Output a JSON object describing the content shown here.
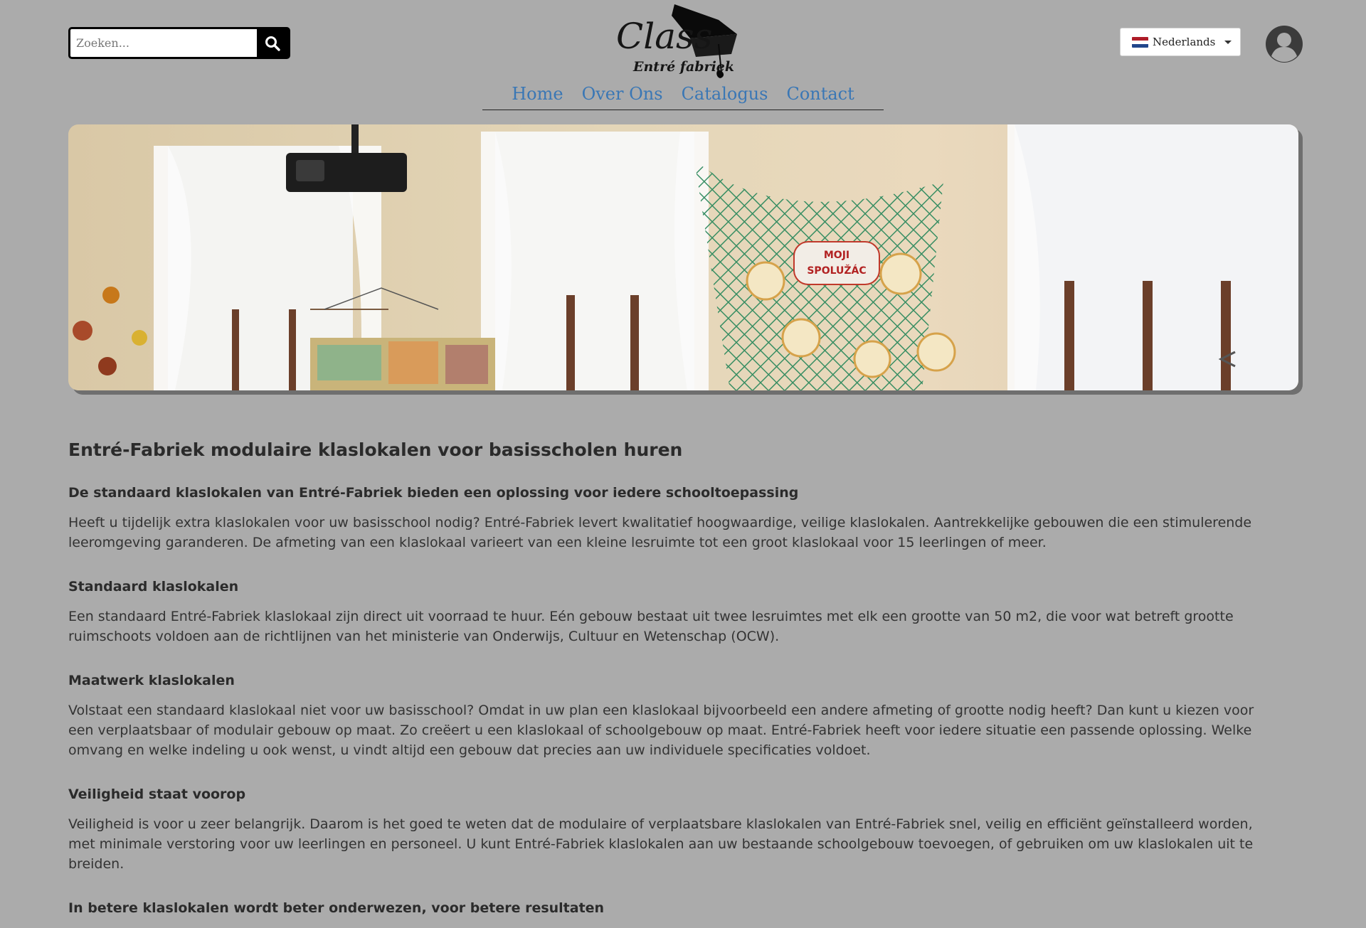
{
  "header": {
    "search": {
      "placeholder": "Zoeken..."
    },
    "logo": {
      "title": "Class",
      "subtitle": "Entré fabriek"
    },
    "language": {
      "selected": "Nederlands",
      "flag_colors": [
        "#ae1c28",
        "#ffffff",
        "#21468b"
      ]
    },
    "nav": [
      {
        "label": "Home"
      },
      {
        "label": "Over Ons"
      },
      {
        "label": "Catalogus"
      },
      {
        "label": "Contact"
      }
    ]
  },
  "banner": {
    "sign_text_1": "MOJI",
    "sign_text_2": "SPOLUŽÁC"
  },
  "content": {
    "title": "Entré-Fabriek modulaire klaslokalen voor basisscholen huren",
    "sections": [
      {
        "heading": "De standaard klaslokalen van Entré-Fabriek bieden een oplossing voor iedere schooltoepassing",
        "text": "Heeft u tijdelijk extra klaslokalen voor uw basisschool nodig? Entré-Fabriek levert kwalitatief hoogwaardige, veilige klaslokalen. Aantrekkelijke gebouwen die een stimulerende leeromgeving garanderen. De afmeting van een klaslokaal varieert van een kleine lesruimte tot een groot klaslokaal voor 15 leerlingen of meer."
      },
      {
        "heading": "Standaard klaslokalen",
        "text": "Een standaard Entré-Fabriek klaslokaal zijn direct uit voorraad te huur. Eén gebouw bestaat uit twee lesruimtes met elk een grootte van 50 m2, die voor wat betreft grootte ruimschoots voldoen aan de richtlijnen van het ministerie van Onderwijs, Cultuur en Wetenschap (OCW)."
      },
      {
        "heading": "Maatwerk klaslokalen",
        "text": "Volstaat een standaard klaslokaal niet voor uw basisschool? Omdat in uw plan een klaslokaal bijvoorbeeld een andere afmeting of grootte nodig heeft? Dan kunt u kiezen voor een verplaatsbaar of modulair gebouw op maat. Zo creëert u een klaslokaal of schoolgebouw op maat. Entré-Fabriek heeft voor iedere situatie een passende oplossing. Welke omvang en welke indeling u ook wenst, u vindt altijd een gebouw dat precies aan uw individuele specificaties voldoet."
      },
      {
        "heading": "Veiligheid staat voorop",
        "text": "Veiligheid is voor u zeer belangrijk. Daarom is het goed te weten dat de modulaire of verplaatsbare klaslokalen van Entré-Fabriek snel, veilig en efficiënt geïnstalleerd worden, met minimale verstoring voor uw leerlingen en personeel. U kunt Entré-Fabriek klaslokalen aan uw bestaande schoolgebouw toevoegen, of gebruiken om uw klaslokalen uit te breiden."
      },
      {
        "heading": "In betere klaslokalen wordt beter onderwezen, voor betere resultaten",
        "text": ""
      }
    ]
  }
}
